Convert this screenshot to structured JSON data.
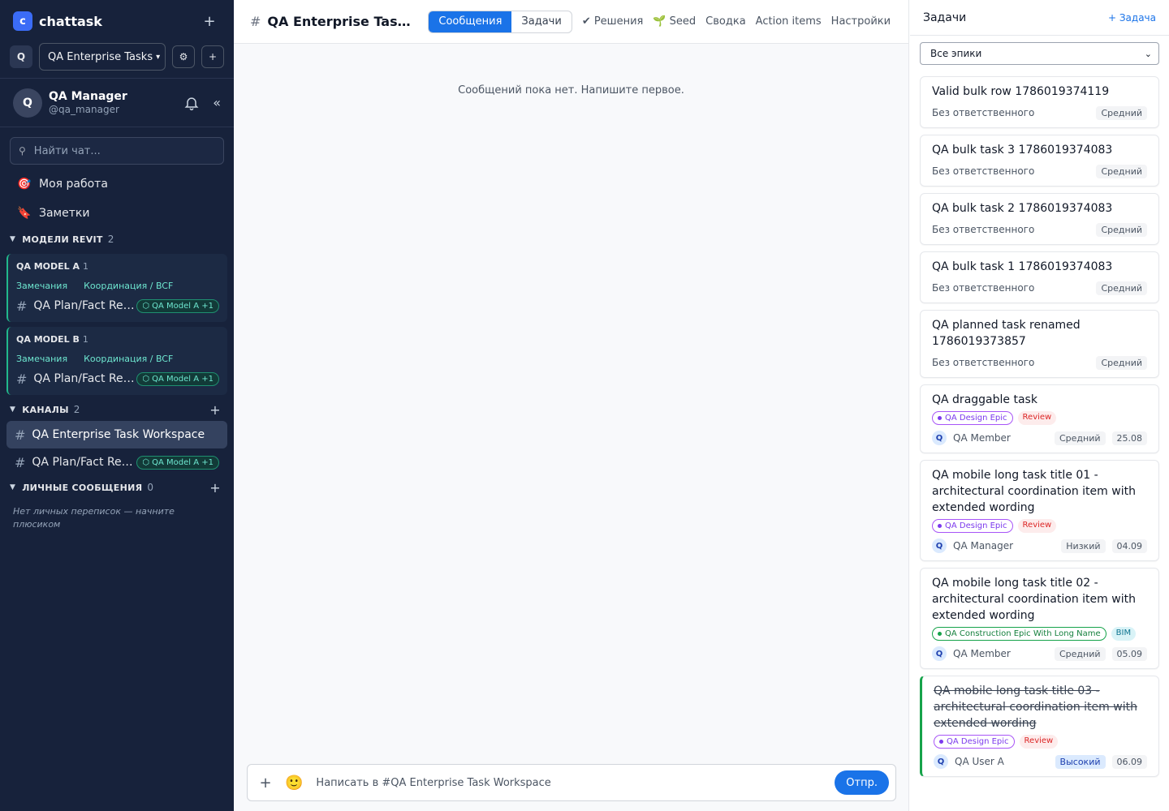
{
  "app": {
    "logo_letter": "c",
    "name": "chattask",
    "new_icon": "plus-icon"
  },
  "workspace": {
    "letter": "Q",
    "name": "QA Enterprise Tasks"
  },
  "user": {
    "avatar": "Q",
    "name": "QA Manager",
    "handle": "@qa_manager"
  },
  "search": {
    "placeholder": "Найти чат..."
  },
  "nav": [
    {
      "icon": "target-icon",
      "glyph": "🎯",
      "label": "Моя работа"
    },
    {
      "icon": "bookmark-icon",
      "glyph": "🔖",
      "label": "Заметки"
    }
  ],
  "revit": {
    "title": "МОДЕЛИ REVIT",
    "count": "2",
    "models": [
      {
        "name": "QA MODEL A",
        "count": "1",
        "link1": "Замечания",
        "link2": "Координация / BCF",
        "channel": "QA Plan/Fact Rep...",
        "tag": "QA Model A +1"
      },
      {
        "name": "QA MODEL B",
        "count": "1",
        "link1": "Замечания",
        "link2": "Координация / BCF",
        "channel": "QA Plan/Fact Rep...",
        "tag": "QA Model A +1"
      }
    ]
  },
  "channels": {
    "title": "КАНАЛЫ",
    "count": "2",
    "items": [
      {
        "name": "QA Enterprise Task Workspace",
        "tag": ""
      },
      {
        "name": "QA Plan/Fact Rep...",
        "tag": "QA Model A +1"
      }
    ]
  },
  "dms": {
    "title": "ЛИЧНЫЕ СООБЩЕНИЯ",
    "count": "0",
    "empty": "Нет личных переписок — начните плюсиком"
  },
  "header": {
    "title": "QA Enterprise Task W...",
    "seg_messages": "Сообщения",
    "seg_tasks": "Задачи",
    "tabs": [
      "✔ Решения",
      "🌱 Seed",
      "Сводка",
      "Action items",
      "Настройки"
    ]
  },
  "chat": {
    "empty": "Сообщений пока нет. Напишите первое."
  },
  "composer": {
    "placeholder": "Написать в #QA Enterprise Task Workspace",
    "send": "Отпр."
  },
  "panel": {
    "title": "Задачи",
    "add": "+ Задача",
    "filter": "Все эпики",
    "tasks": [
      {
        "title": "Valid bulk row 1786019374119",
        "assignee": "Без ответственного",
        "priority": "Средний"
      },
      {
        "title": "QA bulk task 3 1786019374083",
        "assignee": "Без ответственного",
        "priority": "Средний"
      },
      {
        "title": "QA bulk task 2 1786019374083",
        "assignee": "Без ответственного",
        "priority": "Средний"
      },
      {
        "title": "QA bulk task 1 1786019374083",
        "assignee": "Без ответственного",
        "priority": "Средний"
      },
      {
        "title": "QA planned task renamed 1786019373857",
        "assignee": "Без ответственного",
        "priority": "Средний"
      },
      {
        "title": "QA draggable task",
        "epic": "QA Design Epic",
        "status": "Review",
        "assignee": "QA Member",
        "priority": "Средний",
        "due": "25.08"
      },
      {
        "title": "QA mobile long task title 01 - architectural coordination item with extended wording",
        "epic": "QA Design Epic",
        "status": "Review",
        "assignee": "QA Manager",
        "priority": "Низкий",
        "due": "04.09"
      },
      {
        "title": "QA mobile long task title 02 - architectural coordination item with extended wording",
        "epic": "QA Construction Epic With Long Name",
        "status": "BIM",
        "assignee": "QA Member",
        "priority": "Средний",
        "due": "05.09"
      },
      {
        "title": "QA mobile long task title 03 - architectural coordination item with extended wording",
        "epic": "QA Design Epic",
        "status": "Review",
        "assignee": "QA User A",
        "priority": "Высокий",
        "due": "06.09"
      }
    ]
  },
  "colors": {
    "sidebar_bg": "#17223b",
    "accent": "#1a73e8",
    "model_accent": "#21b88c",
    "done": "#16a34a"
  }
}
